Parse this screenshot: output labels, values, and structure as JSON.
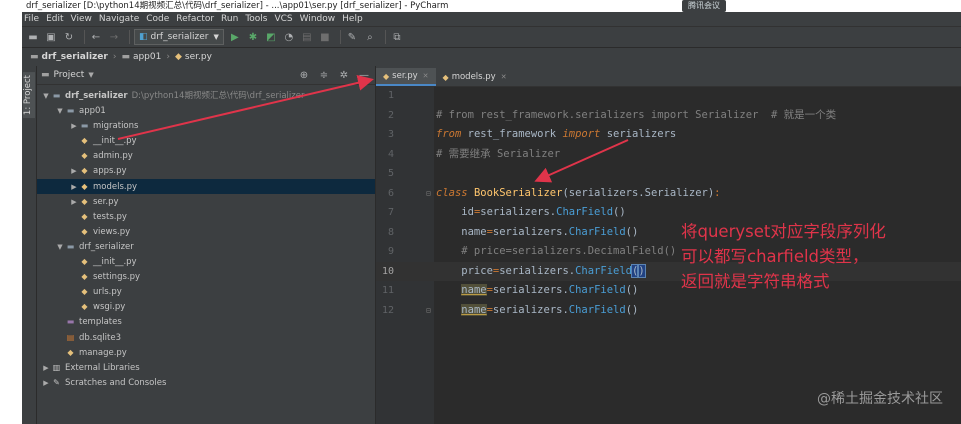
{
  "window": {
    "title": "drf_serializer [D:\\python14期视频汇总\\代码\\drf_serializer] - ...\\app01\\ser.py [drf_serializer] - PyCharm",
    "meeting_badge": "腾讯会议"
  },
  "menu": [
    "File",
    "Edit",
    "View",
    "Navigate",
    "Code",
    "Refactor",
    "Run",
    "Tools",
    "VCS",
    "Window",
    "Help"
  ],
  "toolbar": {
    "run_config": "drf_serializer",
    "icons": [
      "folder-open-icon",
      "save-icon",
      "sync-icon",
      "back-icon",
      "forward-icon",
      "run-icon",
      "debug-icon",
      "coverage-icon",
      "profile-icon",
      "concurrency-icon",
      "stop-icon",
      "settings-icon",
      "search-icon",
      "structure-icon"
    ]
  },
  "breadcrumb": [
    "drf_serializer",
    "app01",
    "ser.py"
  ],
  "side_tab": "1: Project",
  "project_panel": {
    "title": "Project",
    "tree": [
      {
        "depth": 0,
        "arrow": "▼",
        "icon": "folder",
        "label": "drf_serializer",
        "path": "D:\\python14期视频汇总\\代码\\drf_serializer",
        "bold": true
      },
      {
        "depth": 1,
        "arrow": "▼",
        "icon": "pkg",
        "label": "app01"
      },
      {
        "depth": 2,
        "arrow": "▶",
        "icon": "pkg",
        "label": "migrations"
      },
      {
        "depth": 2,
        "arrow": "",
        "icon": "py",
        "label": "__init__.py"
      },
      {
        "depth": 2,
        "arrow": "",
        "icon": "py",
        "label": "admin.py"
      },
      {
        "depth": 2,
        "arrow": "▶",
        "icon": "py",
        "label": "apps.py"
      },
      {
        "depth": 2,
        "arrow": "▶",
        "icon": "py",
        "label": "models.py",
        "selected": true
      },
      {
        "depth": 2,
        "arrow": "▶",
        "icon": "py",
        "label": "ser.py"
      },
      {
        "depth": 2,
        "arrow": "",
        "icon": "py",
        "label": "tests.py"
      },
      {
        "depth": 2,
        "arrow": "",
        "icon": "py",
        "label": "views.py"
      },
      {
        "depth": 1,
        "arrow": "▼",
        "icon": "pkg",
        "label": "drf_serializer"
      },
      {
        "depth": 2,
        "arrow": "",
        "icon": "py",
        "label": "__init__.py"
      },
      {
        "depth": 2,
        "arrow": "",
        "icon": "py",
        "label": "settings.py"
      },
      {
        "depth": 2,
        "arrow": "",
        "icon": "py",
        "label": "urls.py"
      },
      {
        "depth": 2,
        "arrow": "",
        "icon": "py",
        "label": "wsgi.py"
      },
      {
        "depth": 1,
        "arrow": "",
        "icon": "tmpl",
        "label": "templates"
      },
      {
        "depth": 1,
        "arrow": "",
        "icon": "db",
        "label": "db.sqlite3"
      },
      {
        "depth": 1,
        "arrow": "",
        "icon": "py",
        "label": "manage.py"
      },
      {
        "depth": 0,
        "arrow": "▶",
        "icon": "lib",
        "label": "External Libraries"
      },
      {
        "depth": 0,
        "arrow": "▶",
        "icon": "scratch",
        "label": "Scratches and Consoles"
      }
    ]
  },
  "editor": {
    "tabs": [
      {
        "label": "ser.py",
        "active": true
      },
      {
        "label": "models.py",
        "active": false
      }
    ],
    "current_line": 10,
    "lines": [
      {
        "n": "1",
        "tokens": []
      },
      {
        "n": "2",
        "tokens": [
          {
            "t": "# from rest_framework.serializers import Serializer  # 就是一个类",
            "c": "cm"
          }
        ]
      },
      {
        "n": "3",
        "tokens": [
          {
            "t": "from",
            "c": "kw"
          },
          {
            "t": " rest_framework ",
            "c": ""
          },
          {
            "t": "import",
            "c": "kw"
          },
          {
            "t": " serializers",
            "c": ""
          }
        ]
      },
      {
        "n": "4",
        "tokens": [
          {
            "t": "# 需要继承 Serializer",
            "c": "cm"
          }
        ]
      },
      {
        "n": "5",
        "tokens": []
      },
      {
        "n": "6",
        "tokens": [
          {
            "t": "class",
            "c": "kw"
          },
          {
            "t": " ",
            "c": ""
          },
          {
            "t": "BookSerializer",
            "c": "cls"
          },
          {
            "t": "(serializers.Serializer)",
            "c": ""
          },
          {
            "t": ":",
            "c": "op"
          }
        ]
      },
      {
        "n": "7",
        "tokens": [
          {
            "t": "    id",
            "c": ""
          },
          {
            "t": "=",
            "c": "op"
          },
          {
            "t": "serializers.",
            "c": ""
          },
          {
            "t": "CharField",
            "c": "cf"
          },
          {
            "t": "()",
            "c": ""
          }
        ]
      },
      {
        "n": "8",
        "tokens": [
          {
            "t": "    name",
            "c": ""
          },
          {
            "t": "=",
            "c": "op"
          },
          {
            "t": "serializers.",
            "c": ""
          },
          {
            "t": "CharField",
            "c": "cf"
          },
          {
            "t": "()",
            "c": ""
          }
        ]
      },
      {
        "n": "9",
        "tokens": [
          {
            "t": "    # price=serializers.DecimalField()",
            "c": "cm"
          }
        ]
      },
      {
        "n": "10",
        "tokens": [
          {
            "t": "    price",
            "c": ""
          },
          {
            "t": "=",
            "c": "op"
          },
          {
            "t": "serializers.",
            "c": ""
          },
          {
            "t": "CharField",
            "c": "cf"
          },
          {
            "t": "(",
            "c": "caret-box"
          },
          {
            "t": ")",
            "c": "caret-box"
          }
        ]
      },
      {
        "n": "11",
        "tokens": [
          {
            "t": "    ",
            "c": ""
          },
          {
            "t": "name",
            "c": "dup"
          },
          {
            "t": "=",
            "c": "op"
          },
          {
            "t": "serializers.",
            "c": ""
          },
          {
            "t": "CharField",
            "c": "cf"
          },
          {
            "t": "()",
            "c": ""
          }
        ]
      },
      {
        "n": "12",
        "tokens": [
          {
            "t": "    ",
            "c": ""
          },
          {
            "t": "name",
            "c": "dup"
          },
          {
            "t": "=",
            "c": "op"
          },
          {
            "t": "serializers.",
            "c": ""
          },
          {
            "t": "CharField",
            "c": "cf"
          },
          {
            "t": "()",
            "c": ""
          }
        ]
      }
    ]
  },
  "annotation": [
    "将queryset对应字段序列化",
    "可以都写charfield类型，",
    "返回就是字符串格式"
  ],
  "watermark": "@稀土掘金技术社区",
  "colors": {
    "annotation": "#e0344a",
    "arrow": "#e0344a",
    "selected_row": "#0d293e"
  }
}
